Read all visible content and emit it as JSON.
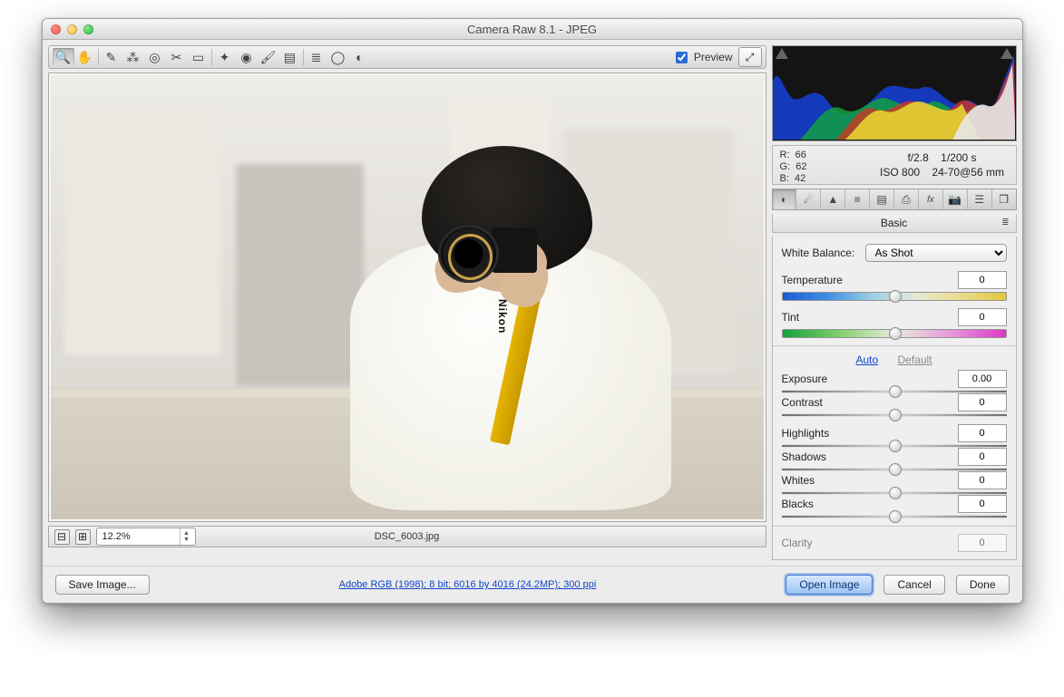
{
  "window": {
    "title": "Camera Raw 8.1  -  JPEG"
  },
  "toolbar": {
    "tools": [
      {
        "name": "zoom-tool-icon",
        "glyph": "🔍",
        "active": true
      },
      {
        "name": "hand-tool-icon",
        "glyph": "✋"
      },
      {
        "name": "white-balance-tool-icon",
        "glyph": "✎"
      },
      {
        "name": "color-sampler-tool-icon",
        "glyph": "⁂"
      },
      {
        "name": "targeted-adjust-tool-icon",
        "glyph": "◎"
      },
      {
        "name": "crop-tool-icon",
        "glyph": "✂"
      },
      {
        "name": "straighten-tool-icon",
        "glyph": "▭"
      },
      {
        "name": "spot-removal-tool-icon",
        "glyph": "✦"
      },
      {
        "name": "red-eye-tool-icon",
        "glyph": "◉"
      },
      {
        "name": "adjustment-brush-tool-icon",
        "glyph": "🖌"
      },
      {
        "name": "graduated-filter-tool-icon",
        "glyph": "▤"
      },
      {
        "name": "radial-filter-tool-icon",
        "glyph": "≣"
      },
      {
        "name": "preferences-tool-icon",
        "glyph": "◯"
      },
      {
        "name": "rotate-tool-icon",
        "glyph": "◐"
      }
    ],
    "preview_checked": true,
    "preview_label": "Preview"
  },
  "photo": {
    "strap_brand": "Nikon"
  },
  "statusbar": {
    "zoom": "12.2%",
    "filename": "DSC_6003.jpg"
  },
  "info": {
    "r_label": "R:",
    "r": "66",
    "g_label": "G:",
    "g": "62",
    "b_label": "B:",
    "b": "42",
    "aperture": "f/2.8",
    "shutter": "1/200 s",
    "iso": "ISO 800",
    "lens": "24-70@56 mm"
  },
  "tabs": [
    {
      "name": "basic",
      "glyph": "◐",
      "active": true
    },
    {
      "name": "tone-curve",
      "glyph": "☄"
    },
    {
      "name": "detail",
      "glyph": "▲"
    },
    {
      "name": "hsl",
      "glyph": "≡"
    },
    {
      "name": "split-toning",
      "glyph": "▤"
    },
    {
      "name": "lens-corrections",
      "glyph": "⎙"
    },
    {
      "name": "effects",
      "glyph": "fx"
    },
    {
      "name": "camera-calibration",
      "glyph": "📷"
    },
    {
      "name": "presets",
      "glyph": "☰"
    },
    {
      "name": "snapshots",
      "glyph": "❐"
    }
  ],
  "panel": {
    "title": "Basic",
    "white_balance_label": "White Balance:",
    "white_balance_value": "As Shot",
    "temperature_label": "Temperature",
    "tint_label": "Tint",
    "auto_label": "Auto",
    "default_label": "Default",
    "sliders": {
      "temperature": "0",
      "tint": "0",
      "exposure_label": "Exposure",
      "exposure": "0.00",
      "contrast_label": "Contrast",
      "contrast": "0",
      "highlights_label": "Highlights",
      "highlights": "0",
      "shadows_label": "Shadows",
      "shadows": "0",
      "whites_label": "Whites",
      "whites": "0",
      "blacks_label": "Blacks",
      "blacks": "0",
      "clarity_label": "Clarity",
      "clarity": "0"
    }
  },
  "buttons": {
    "save_image": "Save Image...",
    "workflow": "Adobe RGB (1998); 8 bit; 6016 by 4016 (24.2MP); 300 ppi",
    "open_image": "Open Image",
    "cancel": "Cancel",
    "done": "Done"
  }
}
